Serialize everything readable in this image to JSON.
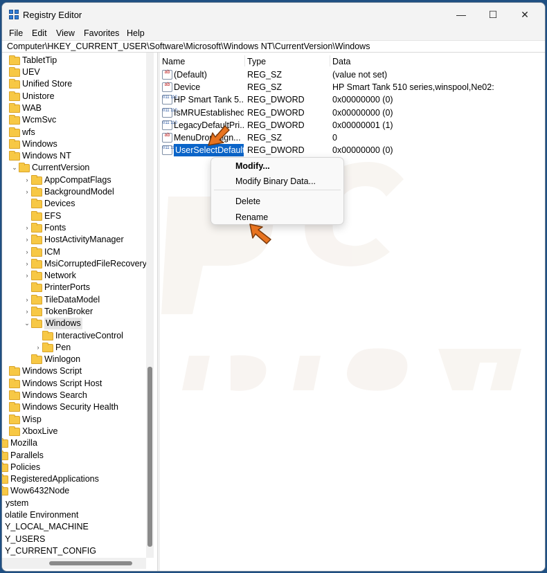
{
  "window": {
    "title": "Registry Editor",
    "controls": {
      "minimize": "—",
      "maximize": "☐",
      "close": "✕"
    }
  },
  "menu": [
    "File",
    "Edit",
    "View",
    "Favorites",
    "Help"
  ],
  "address": "Computer\\HKEY_CURRENT_USER\\Software\\Microsoft\\Windows NT\\CurrentVersion\\Windows",
  "tree": [
    {
      "label": "TabletTip",
      "arrow": ""
    },
    {
      "label": "UEV",
      "arrow": ""
    },
    {
      "label": "Unified Store",
      "arrow": ""
    },
    {
      "label": "Unistore",
      "arrow": ""
    },
    {
      "label": "WAB",
      "arrow": ""
    },
    {
      "label": "WcmSvc",
      "arrow": ""
    },
    {
      "label": "wfs",
      "arrow": ""
    },
    {
      "label": "Windows",
      "arrow": ""
    },
    {
      "label": "Windows NT",
      "arrow": ""
    },
    {
      "label": "CurrentVersion",
      "arrow": "⌄"
    },
    {
      "label": "AppCompatFlags",
      "arrow": "›"
    },
    {
      "label": "BackgroundModel",
      "arrow": "›"
    },
    {
      "label": "Devices",
      "arrow": ""
    },
    {
      "label": "EFS",
      "arrow": ""
    },
    {
      "label": "Fonts",
      "arrow": "›"
    },
    {
      "label": "HostActivityManager",
      "arrow": "›"
    },
    {
      "label": "ICM",
      "arrow": "›"
    },
    {
      "label": "MsiCorruptedFileRecovery",
      "arrow": "›"
    },
    {
      "label": "Network",
      "arrow": "›"
    },
    {
      "label": "PrinterPorts",
      "arrow": ""
    },
    {
      "label": "TileDataModel",
      "arrow": "›"
    },
    {
      "label": "TokenBroker",
      "arrow": "›"
    },
    {
      "label": "Windows",
      "arrow": "⌄"
    },
    {
      "label": "InteractiveControl",
      "arrow": ""
    },
    {
      "label": "Pen",
      "arrow": "›"
    },
    {
      "label": "Winlogon",
      "arrow": ""
    },
    {
      "label": "Windows Script",
      "arrow": ""
    },
    {
      "label": "Windows Script Host",
      "arrow": ""
    },
    {
      "label": "Windows Search",
      "arrow": ""
    },
    {
      "label": "Windows Security Health",
      "arrow": ""
    },
    {
      "label": "Wisp",
      "arrow": ""
    },
    {
      "label": "XboxLive",
      "arrow": ""
    },
    {
      "label": "Mozilla",
      "arrow": ""
    },
    {
      "label": "Parallels",
      "arrow": ""
    },
    {
      "label": "Policies",
      "arrow": ""
    },
    {
      "label": "RegisteredApplications",
      "arrow": ""
    },
    {
      "label": "Wow6432Node",
      "arrow": ""
    },
    {
      "label": "ystem",
      "arrow": ""
    },
    {
      "label": "olatile Environment",
      "arrow": ""
    },
    {
      "label": "Y_LOCAL_MACHINE",
      "arrow": ""
    },
    {
      "label": "Y_USERS",
      "arrow": ""
    },
    {
      "label": "Y_CURRENT_CONFIG",
      "arrow": ""
    }
  ],
  "columns": {
    "name": "Name",
    "type": "Type",
    "data": "Data"
  },
  "values": [
    {
      "name": "(Default)",
      "type": "REG_SZ",
      "data": "(value not set)",
      "icon": "string-value-icon",
      "icon_text": "ab"
    },
    {
      "name": "Device",
      "type": "REG_SZ",
      "data": "HP Smart Tank 510 series,winspool,Ne02:",
      "icon": "string-value-icon",
      "icon_text": "ab"
    },
    {
      "name": "HP Smart Tank 5...",
      "type": "REG_DWORD",
      "data": "0x00000000 (0)",
      "icon": "binary-value-icon",
      "icon_text": "011 110"
    },
    {
      "name": "IsMRUEstablished",
      "type": "REG_DWORD",
      "data": "0x00000000 (0)",
      "icon": "binary-value-icon",
      "icon_text": "011 110"
    },
    {
      "name": "LegacyDefaultPri...",
      "type": "REG_DWORD",
      "data": "0x00000001 (1)",
      "icon": "binary-value-icon",
      "icon_text": "011 110"
    },
    {
      "name": "MenuDropAlign...",
      "type": "REG_SZ",
      "data": "0",
      "icon": "string-value-icon",
      "icon_text": "ab"
    },
    {
      "name": "UserSelectDefault",
      "type": "REG_DWORD",
      "data": "0x00000000 (0)",
      "icon": "binary-value-icon",
      "icon_text": "011 110"
    }
  ],
  "context_menu": {
    "modify": "Modify...",
    "modify_binary": "Modify Binary Data...",
    "delete": "Delete",
    "rename": "Rename"
  },
  "colors": {
    "selection": "#0a64c8",
    "arrow": "#e8731f",
    "folder": "#f7c845"
  }
}
